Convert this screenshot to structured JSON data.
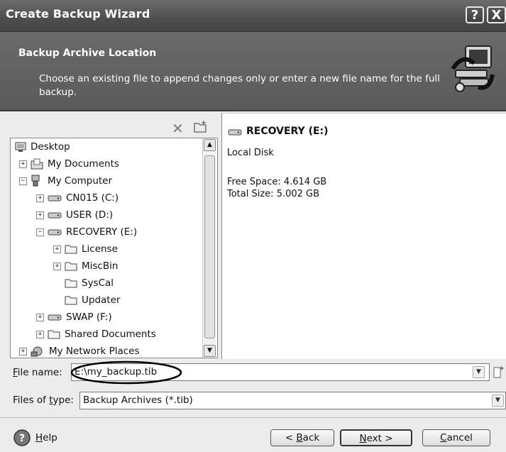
{
  "window": {
    "title": "Create Backup Wizard",
    "help_glyph": "?",
    "close_glyph": "X"
  },
  "header": {
    "heading": "Backup Archive Location",
    "description": "Choose an existing file to append changes only or enter a new file name for the full backup."
  },
  "toolbar": {
    "delete_icon": "close-icon",
    "new_folder_icon": "new-folder-icon"
  },
  "tree": {
    "items": [
      {
        "label": "Desktop",
        "icon": "desktop-icon",
        "expander": ""
      },
      {
        "label": "My Documents",
        "icon": "documents-folder-icon",
        "expander": "+"
      },
      {
        "label": "My Computer",
        "icon": "computer-icon",
        "expander": "−"
      },
      {
        "label": "CN015 (C:)",
        "icon": "drive-icon",
        "expander": "+"
      },
      {
        "label": "USER (D:)",
        "icon": "drive-icon",
        "expander": "+"
      },
      {
        "label": "RECOVERY (E:)",
        "icon": "drive-icon",
        "expander": "−"
      },
      {
        "label": "License",
        "icon": "folder-icon",
        "expander": "+"
      },
      {
        "label": "MiscBin",
        "icon": "folder-icon",
        "expander": "+"
      },
      {
        "label": "SysCal",
        "icon": "folder-icon",
        "expander": ""
      },
      {
        "label": "Updater",
        "icon": "folder-icon",
        "expander": ""
      },
      {
        "label": "SWAP (F:)",
        "icon": "drive-icon",
        "expander": "+"
      },
      {
        "label": "Shared Documents",
        "icon": "folder-icon",
        "expander": "+"
      },
      {
        "label": "My Network Places",
        "icon": "network-icon",
        "expander": "+"
      }
    ]
  },
  "details": {
    "title": "RECOVERY (E:)",
    "type": "Local Disk",
    "free_space": "Free Space: 4.614 GB",
    "total_size": "Total Size: 5.002 GB"
  },
  "form": {
    "file_name_label_pre": "",
    "file_name_label_key": "F",
    "file_name_label_post": "ile name:",
    "file_name_value": "E:\\my_backup.tib",
    "files_of_type_label_pre": "Files of ",
    "files_of_type_label_key": "t",
    "files_of_type_label_post": "ype:",
    "files_of_type_value": "Backup Archives (*.tib)"
  },
  "footer": {
    "help_key": "H",
    "help_rest": "elp",
    "back_pre": "< ",
    "back_key": "B",
    "back_rest": "ack",
    "next_key": "N",
    "next_rest": "ext >",
    "cancel_key": "C",
    "cancel_rest": "ancel"
  },
  "colors": {
    "title_bar": "#4e4e4e",
    "header_bg": "#5f5f5f",
    "annotation_circle": "#000000"
  }
}
